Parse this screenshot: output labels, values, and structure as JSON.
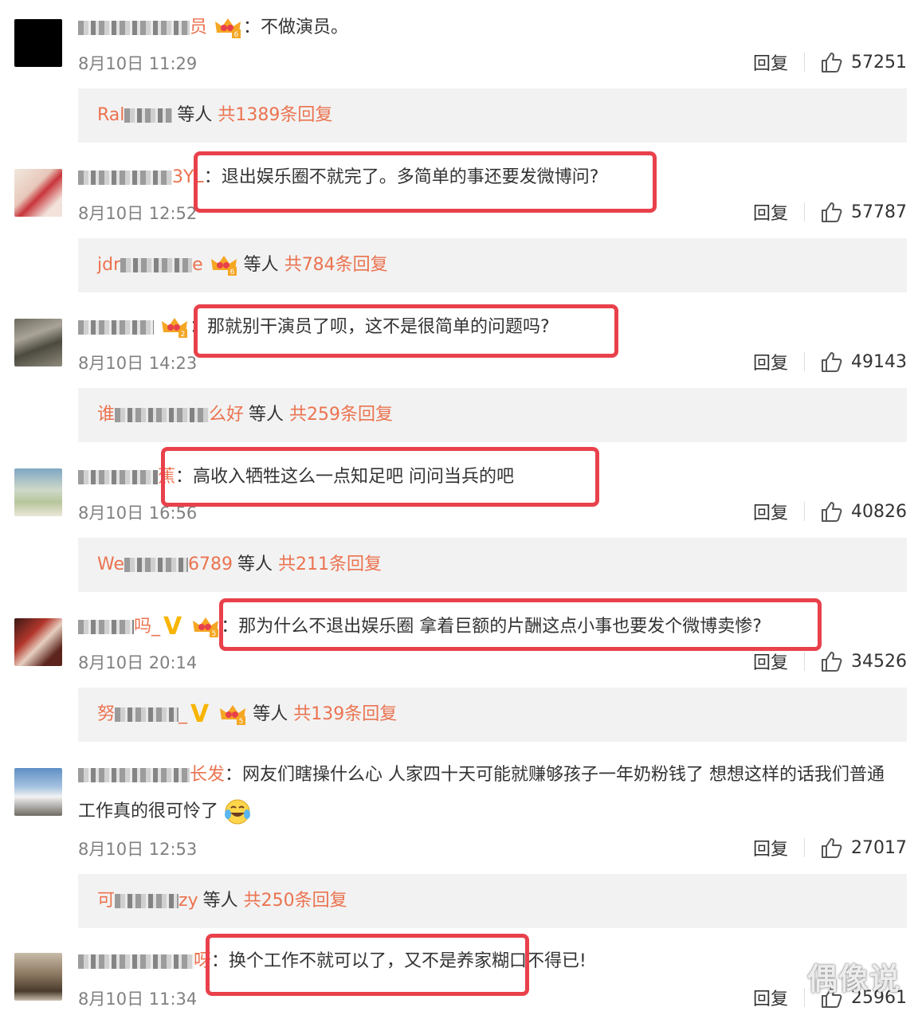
{
  "comments": [
    {
      "username": "员",
      "text": "不做演员。",
      "time": "8月10日 11:29",
      "reply": "回复",
      "likes": "57251",
      "preview_name": "Ral",
      "more": "等人",
      "total": "共1389条回复",
      "level": "6"
    },
    {
      "username": "3YL",
      "text": "退出娱乐圈不就完了。多简单的事还要发微博问?",
      "time": "8月10日 12:52",
      "reply": "回复",
      "likes": "57787",
      "preview_name": "jdr",
      "preview_suffix": "e",
      "more": "等人",
      "total": "共784条回复",
      "level": "6"
    },
    {
      "username": "",
      "text": "那就别干演员了呗，这不是很简单的问题吗?",
      "time": "8月10日 14:23",
      "reply": "回复",
      "likes": "49143",
      "preview_name": "谁",
      "preview_suffix": "么好",
      "more": "等人",
      "total": "共259条回复",
      "level": "2"
    },
    {
      "username": "蕉",
      "text": "高收入牺牲这么一点知足吧  问问当兵的吧",
      "time": "8月10日 16:56",
      "reply": "回复",
      "likes": "40826",
      "preview_name": "We",
      "preview_suffix": "6789",
      "more": "等人",
      "total": "共211条回复"
    },
    {
      "username": "吗_",
      "text": "那为什么不退出娱乐圈 拿着巨额的片酬这点小事也要发个微博卖惨?",
      "time": "8月10日 20:14",
      "reply": "回复",
      "likes": "34526",
      "preview_name": "努",
      "preview_suffix": "_",
      "more": "等人",
      "total": "共139条回复",
      "level": "5"
    },
    {
      "username": "长发",
      "text": "网友们瞎操什么心 人家四十天可能就赚够孩子一年奶粉钱了 想想这样的话我们普通工作真的很可怜了",
      "time": "8月10日 12:53",
      "reply": "回复",
      "likes": "27017",
      "preview_name": "可",
      "preview_suffix": "zy",
      "more": "等人",
      "total": "共250条回复"
    },
    {
      "username": "呀",
      "text": "换个工作不就可以了，又不是养家糊口不得已!",
      "time": "8月10日 11:34",
      "reply": "回复",
      "likes": "25961"
    }
  ],
  "colors": {
    "username": "#eb7350",
    "highlight": "#e8414b",
    "reply_bg": "#f2f2f2",
    "time": "#808080"
  },
  "watermark": "偶像说"
}
